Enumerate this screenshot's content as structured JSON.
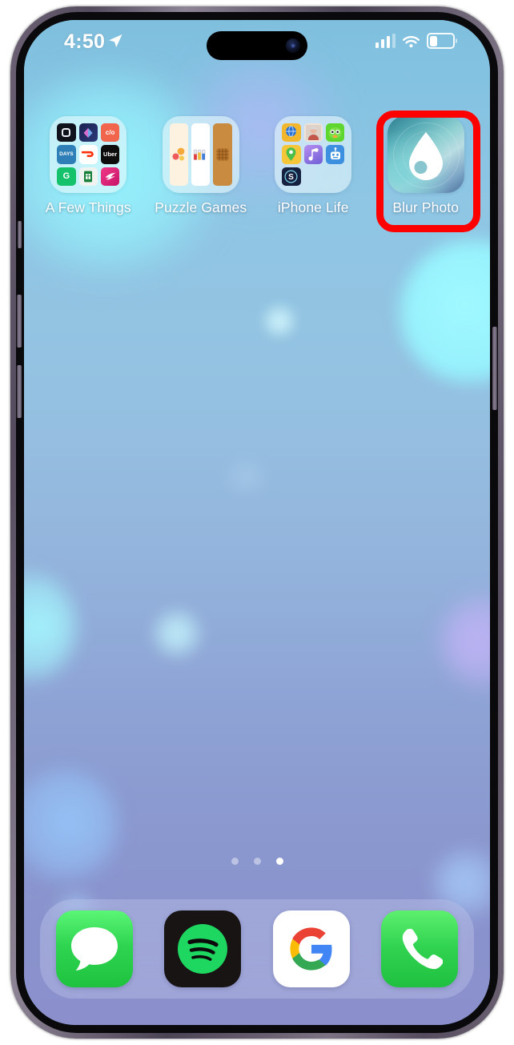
{
  "device": {
    "name": "iPhone",
    "frame_color": "#6d6275",
    "screen_bg": "#8fc3e0"
  },
  "status_bar": {
    "time": "4:50",
    "location_icon": "location-arrow-icon",
    "cellular_icon": "cellular-signal-icon",
    "cellular_bars_filled": 3,
    "cellular_bars_total": 4,
    "wifi_icon": "wifi-icon",
    "battery_icon": "battery-icon",
    "battery_percent": 31
  },
  "home_screen": {
    "apps": [
      {
        "label": "A Few Things",
        "type": "folder",
        "name": "folder-a-few-things",
        "mini_icons": [
          {
            "name": "mini-icon-dark-square",
            "text": "",
            "bg": "#10131c",
            "fg": "#ffffff"
          },
          {
            "name": "mini-icon-shortcuts",
            "text": "",
            "bg": "#1b2550",
            "fg": "#ffffff"
          },
          {
            "name": "mini-icon-co",
            "text": "c/o",
            "bg": "#f0654c",
            "fg": "#ffffff"
          },
          {
            "name": "mini-icon-days",
            "text": "DAYS",
            "bg": "#2e7fb8",
            "fg": "#ffffff"
          },
          {
            "name": "mini-icon-doordash",
            "text": "",
            "bg": "#ffffff",
            "fg": "#ff3008"
          },
          {
            "name": "mini-icon-uber",
            "text": "Uber",
            "bg": "#0d0d0d",
            "fg": "#ffffff"
          },
          {
            "name": "mini-icon-grammarly",
            "text": "G",
            "bg": "#15c26b",
            "fg": "#ffffff"
          },
          {
            "name": "mini-icon-google-sheets",
            "text": "",
            "bg": "#f1f3f0",
            "fg": "#188038"
          },
          {
            "name": "mini-icon-pink-bird",
            "text": "",
            "bg": "#e8246e",
            "fg": "#ffffff"
          }
        ]
      },
      {
        "label": "Puzzle Games",
        "type": "folder",
        "name": "folder-puzzle-games",
        "mini_icons": [
          {
            "name": "mini-icon-bubble-puzzle",
            "text": "",
            "bg": "#fdf1e0",
            "fg": "#e8603c"
          },
          {
            "name": "mini-icon-water-sort",
            "text": "",
            "bg": "#ffffff",
            "fg": "#3355cc"
          },
          {
            "name": "mini-icon-wood-block",
            "text": "",
            "bg": "#c98b3f",
            "fg": "#7a4a16"
          }
        ]
      },
      {
        "label": "iPhone Life",
        "type": "folder",
        "name": "folder-iphone-life",
        "mini_icons": [
          {
            "name": "mini-icon-globe-browser",
            "text": "",
            "bg": "#f2b72c",
            "fg": "#2a6fd4"
          },
          {
            "name": "mini-icon-portrait-photo",
            "text": "",
            "bg": "#e8d4c6",
            "fg": "#8a5a44"
          },
          {
            "name": "mini-icon-duolingo",
            "text": "",
            "bg": "#5fd62e",
            "fg": "#ffffff"
          },
          {
            "name": "mini-icon-location-pin",
            "text": "",
            "bg": "#f5c53a",
            "fg": "#4bbf4a"
          },
          {
            "name": "mini-icon-music-note",
            "text": "",
            "bg": "#9b7ae0",
            "fg": "#ffffff"
          },
          {
            "name": "mini-icon-robot-chat",
            "text": "",
            "bg": "#3d8fe0",
            "fg": "#ffffff"
          },
          {
            "name": "mini-icon-s-badge",
            "text": "S",
            "bg": "#16203f",
            "fg": "#ffffff"
          }
        ]
      },
      {
        "label": "Blur Photo",
        "type": "app",
        "name": "app-blur-photo",
        "icon": "water-droplet-icon",
        "highlighted": true
      }
    ],
    "highlight_color": "#ff0000",
    "page_dots": {
      "total": 3,
      "active_index": 2
    }
  },
  "dock": {
    "items": [
      {
        "label": "Messages",
        "name": "dock-app-messages",
        "icon": "message-bubble-icon",
        "bg": "#2fd551"
      },
      {
        "label": "Spotify",
        "name": "dock-app-spotify",
        "icon": "spotify-icon",
        "bg": "#191414"
      },
      {
        "label": "Google",
        "name": "dock-app-google",
        "icon": "google-g-icon",
        "bg": "#ffffff"
      },
      {
        "label": "Phone",
        "name": "dock-app-phone",
        "icon": "phone-handset-icon",
        "bg": "#30d350"
      }
    ]
  }
}
